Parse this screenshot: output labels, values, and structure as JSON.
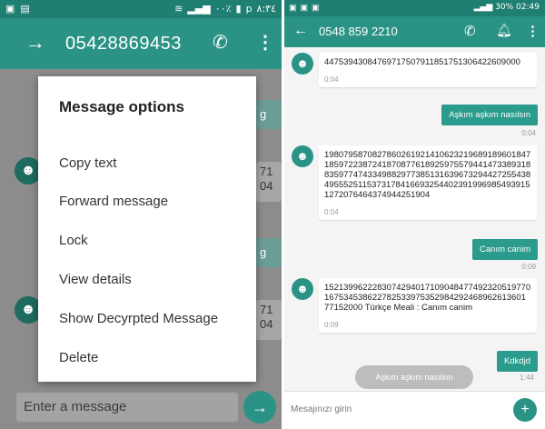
{
  "left": {
    "status": {
      "time": "۸:۳٤",
      "battery_pct": "۰۰٪",
      "network": "p"
    },
    "toolbar": {
      "title": "05428869453"
    },
    "background": {
      "fragment_g1": "g",
      "fragment_g2": "g",
      "fragment_71a": "71",
      "fragment_04a": "04",
      "fragment_71b": "71",
      "fragment_04b": "04"
    },
    "dialog": {
      "title": "Message options",
      "options": [
        "Copy text",
        "Forward message",
        "Lock",
        "View details",
        "Show Decyrpted Message",
        "Delete"
      ]
    },
    "composer": {
      "placeholder": "Enter a message"
    }
  },
  "right": {
    "status": {
      "text": "30% 02:49"
    },
    "toolbar": {
      "title": "0548 859 2210"
    },
    "messages": [
      {
        "dir": "in",
        "text": "44753943084769717507911851751306422609000",
        "time": "0:04"
      },
      {
        "dir": "out",
        "text": "Aşkım aşkım nasılsın",
        "time": "0:04"
      },
      {
        "dir": "in",
        "text": "19807958708278602619214106232196891896018471859722387241870877618925975579441473389318835977474334988297738513163967329442725543849555251153731784166932544023919969854939151272076464374944251904",
        "time": "0:04"
      },
      {
        "dir": "out",
        "text": "Canım canim",
        "time": "0:09"
      },
      {
        "dir": "in",
        "text": "1521399622283074294017109048477492320519770167534538622782533975352984292468962613601 77152000 Türkçe Meali : Canım canim",
        "time": "0:09"
      },
      {
        "dir": "out",
        "text": "Kdkdjd",
        "time": "1:44"
      }
    ],
    "pending": "Aşkım aşkım nasılsın",
    "composer": {
      "placeholder": "Mesajınızı girin"
    }
  },
  "colors": {
    "teal": "#2a9385",
    "teal_dark": "#1f7f72",
    "bubble_out": "#2a9b8d"
  }
}
